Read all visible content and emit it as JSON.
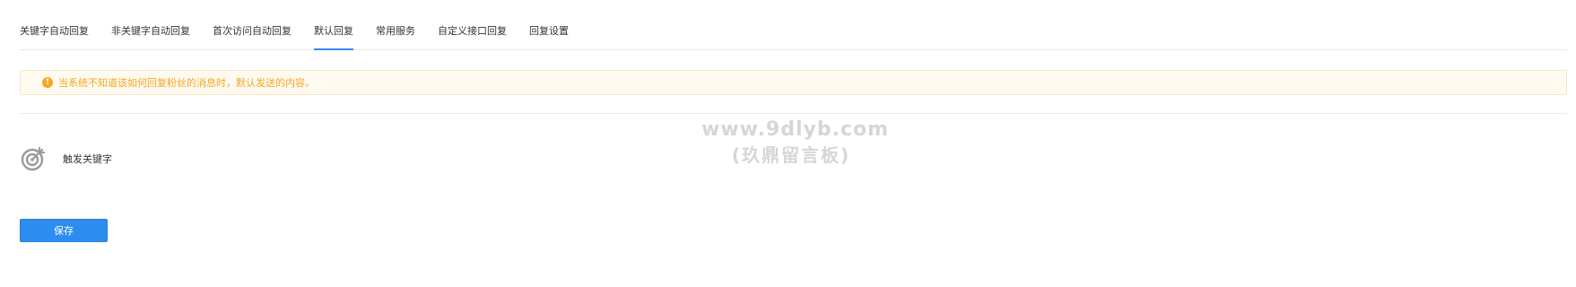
{
  "tabs": [
    {
      "label": "关键字自动回复",
      "active": false
    },
    {
      "label": "非关键字自动回复",
      "active": false
    },
    {
      "label": "首次访问自动回复",
      "active": false
    },
    {
      "label": "默认回复",
      "active": true
    },
    {
      "label": "常用服务",
      "active": false
    },
    {
      "label": "自定义接口回复",
      "active": false
    },
    {
      "label": "回复设置",
      "active": false
    }
  ],
  "notice": {
    "icon": "info-icon",
    "text": "当系统不知道该如何回复粉丝的消息时，默认发送的内容。"
  },
  "watermark": {
    "line1": "www.9dlyb.com",
    "line2": "(玖鼎留言板)"
  },
  "trigger": {
    "icon": "target-icon",
    "label": "触发关键字"
  },
  "actions": {
    "save_label": "保存"
  },
  "colors": {
    "accent": "#2d8cf0",
    "warning": "#f5a623",
    "notice_bg": "#fffaf0"
  }
}
